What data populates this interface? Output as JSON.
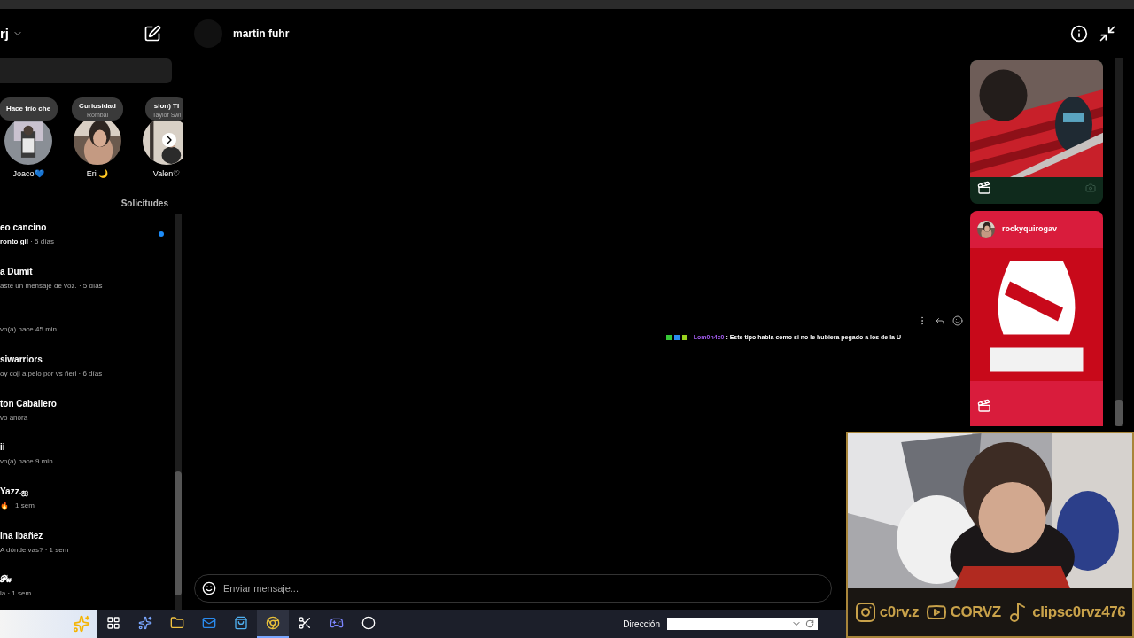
{
  "sidebar": {
    "username": "rj",
    "stories": [
      {
        "note": "Hace frío che",
        "name": "Joaco💙"
      },
      {
        "note": "Curiosidad",
        "sub": "Rombai",
        "name": "Eri 🌙"
      },
      {
        "note": "sion)  Tl",
        "sub": "Taylor Swi",
        "name": "Valen♡"
      }
    ],
    "requests": "Solicitudes",
    "conversations": [
      {
        "name": "eo cancino",
        "preview": "ronto gil",
        "time": " · 5 días",
        "unread": true
      },
      {
        "name": "a Dumit",
        "preview": "aste un mensaje de voz.",
        "time": " · 5 días",
        "unread": false
      },
      {
        "preview": "vo(a) hace 45 min",
        "unread": false
      },
      {
        "name": "siwarriors",
        "preview": "oy coji a pelo por vs ñeri",
        "time": " · 6 días",
        "unread": false
      },
      {
        "name": "ton Caballero",
        "preview": "vo ahora",
        "unread": false
      },
      {
        "name": "ii",
        "preview": "vo(a) hace 9 min",
        "unread": false
      },
      {
        "name": "Yazz.ஐ",
        "preview": "🔥",
        "time": " · 1 sem",
        "unread": false
      },
      {
        "name": "ina Ibañez",
        "preview": "A dónde vas?",
        "time": " · 1 sem",
        "unread": false
      },
      {
        "name": "𝓟𝓾",
        "preview": "la",
        "time": " · 1 sem",
        "unread": false
      }
    ]
  },
  "chat": {
    "contact": "martin fuhr",
    "placeholder": "Enviar mensaje...",
    "overlay": {
      "user": "Lom0n4c0",
      "separator": " : ",
      "text": "Este tipo habla como si no le hubiera pegado a los de la U"
    },
    "posts": [
      {
        "kind": "reel"
      },
      {
        "kind": "post",
        "author": "rockyquirogav"
      }
    ]
  },
  "taskbar": {
    "apps": [
      {
        "kind": "taskview",
        "active": false
      },
      {
        "kind": "copilot",
        "active": false
      },
      {
        "kind": "files",
        "active": false
      },
      {
        "kind": "outlook",
        "active": false
      },
      {
        "kind": "store",
        "active": false
      },
      {
        "kind": "chrome",
        "active": true
      },
      {
        "kind": "capcut",
        "active": false
      },
      {
        "kind": "discord",
        "active": false
      },
      {
        "kind": "obs",
        "active": false
      }
    ],
    "address_label": "Dirección"
  },
  "webcam": {
    "socials": [
      {
        "kind": "instagram",
        "handle": "c0rv.z"
      },
      {
        "kind": "youtube",
        "handle": "CORVZ"
      },
      {
        "kind": "tiktok",
        "handle": "clipsc0rvz476"
      }
    ]
  }
}
